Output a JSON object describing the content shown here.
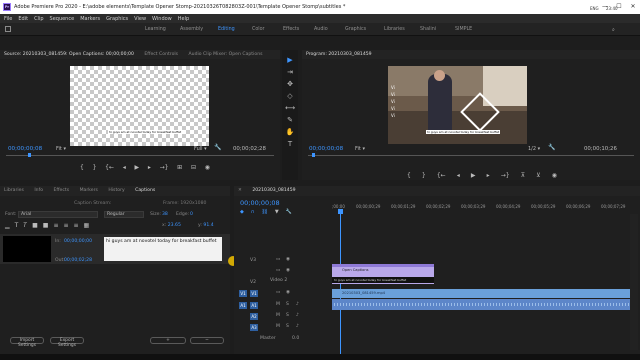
{
  "app": {
    "title": "Adobe Premiere Pro 2020 - E:\\adobe elements\\Template Opener Stomp-20210326T082803Z-001\\Template Opener Stomp\\subtitles *",
    "icon_label": "Pr"
  },
  "window_controls": [
    "—",
    "☐",
    "✕"
  ],
  "menu": [
    "File",
    "Edit",
    "Clip",
    "Sequence",
    "Markers",
    "Graphics",
    "View",
    "Window",
    "Help"
  ],
  "workspaces": [
    {
      "label": "Learning",
      "active": false
    },
    {
      "label": "Assembly",
      "active": false
    },
    {
      "label": "Editing",
      "active": true
    },
    {
      "label": "Color",
      "active": false
    },
    {
      "label": "Effects",
      "active": false
    },
    {
      "label": "Audio",
      "active": false
    },
    {
      "label": "Graphics",
      "active": false
    },
    {
      "label": "Libraries",
      "active": false
    },
    {
      "label": "Shalini",
      "active": false
    },
    {
      "label": "SIMPLE",
      "active": false
    }
  ],
  "source": {
    "tabs": [
      "Source: 20210303_081459: Open Captions: 00;00;00;00",
      "Effect Controls",
      "Audio Clip Mixer: Open Captions"
    ],
    "caption_preview": "hi guys am at novotel today for breakfast buffet",
    "timecode_in": "00;00;00;08",
    "fit": "Fit",
    "quality": "Full",
    "timecode_out": "00;00;02;28"
  },
  "program": {
    "tab": "Program: 20210303_081459",
    "caption_preview": "hi guys am at novotel today for breakfast buffet",
    "timecode_in": "00;00;00;08",
    "fit": "Fit",
    "quality": "1/2",
    "timecode_out": "00;00;10;26",
    "overlay_text": [
      "Vi",
      "Vi",
      "Vi",
      "Vi",
      "Vi"
    ]
  },
  "captions_panel": {
    "tabs": [
      "Libraries",
      "Info",
      "Effects",
      "Markers",
      "History",
      "Captions"
    ],
    "active_tab": "Captions",
    "stream_label": "Caption Stream:",
    "frame_label": "Frame: 1920x1080",
    "font_label": "Font:",
    "font_value": "Arial",
    "style_value": "Regular",
    "size_label": "Size:",
    "size_value": "38",
    "edge_label": "Edge:",
    "edge_value": "0",
    "x_value": "23.65",
    "y_value": "91.4",
    "entry": {
      "in_label": "In:",
      "in_tc": "00;00;00;00",
      "out_label": "Out:",
      "out_tc": "00;00;02;28",
      "text": "hi guys am at novotel today for breakfast buffet"
    },
    "import_btn": "Import Settings",
    "export_btn": "Export Settings",
    "plus": "+",
    "minus": "−"
  },
  "tools": [
    "▶",
    "⇥",
    "✥",
    "◇",
    "⟷",
    "✎",
    "✋",
    "T"
  ],
  "timeline": {
    "tab": "20210303_081459",
    "timecode": "00;00;00;08",
    "ruler": [
      ";00;00",
      "00;00;00;29",
      "00;00;01;29",
      "00;00;02;29",
      "00;00;03;29",
      "00;00;04;29",
      "00;00;05;29",
      "00;00;06;29",
      "00;00;07;29"
    ],
    "tracks": {
      "v3": "V3",
      "v2": "V2",
      "v1": "V1",
      "a1": "A1",
      "a2": "A2",
      "a3": "A3",
      "video2": "Video 2",
      "master": "Master",
      "master_val": "0.0",
      "src_v1": "V1",
      "src_a1": "A1"
    },
    "clip_caption": "Open Captions",
    "clip_caption_sub": "hi guys am at novotel today for breakfast buffet",
    "clip_video": "20210303_081459.mp4"
  },
  "taskbar": {
    "lang": "ENG",
    "time": "23:40"
  },
  "colors": {
    "accent": "#3d95ff",
    "caption_clip": "#b9a8ea",
    "video_clip": "#6aa0da",
    "audio_clip": "#5d86c9"
  }
}
